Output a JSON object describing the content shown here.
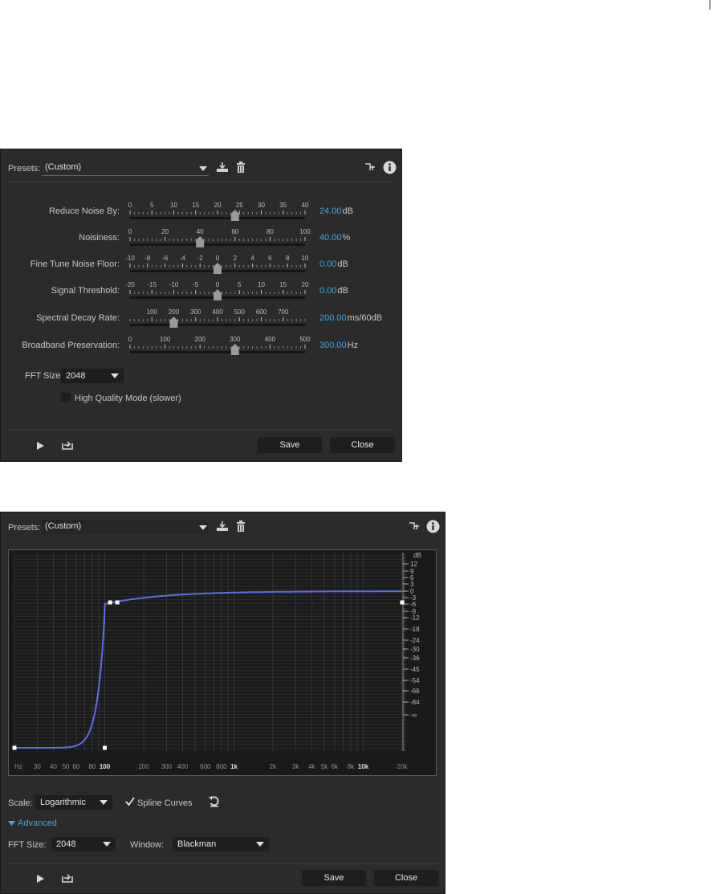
{
  "panel1": {
    "presets_label": "Presets:",
    "preset_value": "(Custom)",
    "sliders": [
      {
        "id": "reduce-noise",
        "label": "Reduce Noise By:",
        "ticks": [
          "0",
          "5",
          "10",
          "15",
          "20",
          "25",
          "30",
          "35",
          "40"
        ],
        "min": 0,
        "max": 40,
        "value": 24,
        "value_text": "24.00",
        "unit": "dB",
        "tick_numeric": [
          0,
          5,
          10,
          15,
          20,
          25,
          30,
          35,
          40
        ]
      },
      {
        "id": "noisiness",
        "label": "Noisiness:",
        "ticks": [
          "0",
          "20",
          "40",
          "60",
          "80",
          "100"
        ],
        "min": 0,
        "max": 100,
        "value": 40,
        "value_text": "40.00",
        "unit": "%",
        "tick_numeric": [
          0,
          20,
          40,
          60,
          80,
          100
        ]
      },
      {
        "id": "fine-tune",
        "label": "Fine Tune Noise Floor:",
        "ticks": [
          "-10",
          "-8",
          "-6",
          "-4",
          "-2",
          "0",
          "2",
          "4",
          "6",
          "8",
          "10"
        ],
        "min": -10,
        "max": 10,
        "value": 0,
        "value_text": "0.00",
        "unit": "dB",
        "tick_numeric": [
          -10,
          -8,
          -6,
          -4,
          -2,
          0,
          2,
          4,
          6,
          8,
          10
        ]
      },
      {
        "id": "signal-threshold",
        "label": "Signal Threshold:",
        "ticks": [
          "-20",
          "-15",
          "-10",
          "-5",
          "0",
          "5",
          "10",
          "15",
          "20"
        ],
        "min": -20,
        "max": 20,
        "value": 0,
        "value_text": "0.00",
        "unit": "dB",
        "tick_numeric": [
          -20,
          -15,
          -10,
          -5,
          0,
          5,
          10,
          15,
          20
        ]
      },
      {
        "id": "spectral-decay",
        "label": "Spectral Decay Rate:",
        "ticks": [
          "100",
          "200",
          "300",
          "400",
          "500",
          "600",
          "700"
        ],
        "min": 0,
        "max": 800,
        "value": 200,
        "value_text": "200.00",
        "unit": "ms/60dB",
        "tick_numeric": [
          100,
          200,
          300,
          400,
          500,
          600,
          700
        ]
      },
      {
        "id": "broadband",
        "label": "Broadband Preservation:",
        "ticks": [
          "0",
          "100",
          "200",
          "300",
          "400",
          "500"
        ],
        "min": 0,
        "max": 500,
        "value": 300,
        "value_text": "300.00",
        "unit": "Hz",
        "tick_numeric": [
          0,
          100,
          200,
          300,
          400,
          500
        ]
      }
    ],
    "fft_label": "FFT Size:",
    "fft_value": "2048",
    "hq_label": "High Quality Mode (slower)",
    "save_label": "Save",
    "close_label": "Close"
  },
  "panel2": {
    "presets_label": "Presets:",
    "preset_value": "(Custom)",
    "graph": {
      "x_ticks": [
        "Hz",
        "30",
        "40",
        "50",
        "60",
        "80",
        "100",
        "200",
        "300",
        "400",
        "600",
        "800",
        "1k",
        "2k",
        "3k",
        "4k",
        "5k",
        "6k",
        "8k",
        "10k",
        "20k"
      ],
      "x_ticks_bold": [
        "100",
        "1k",
        "10k"
      ],
      "x_tick_hz": [
        20,
        30,
        40,
        50,
        60,
        80,
        100,
        200,
        300,
        400,
        600,
        800,
        1000,
        2000,
        3000,
        4000,
        5000,
        6000,
        8000,
        10000,
        20000
      ],
      "y_unit": "dB",
      "y_ticks": [
        "12",
        "9",
        "6",
        "3",
        "0",
        "-3",
        "-6",
        "-9",
        "-12",
        "-18",
        "-24",
        "-30",
        "-36",
        "-45",
        "-54",
        "-66",
        "-84",
        "-∞"
      ],
      "y_tick_db": [
        12,
        9,
        6,
        3,
        0,
        -3,
        -6,
        -9,
        -12,
        -18,
        -24,
        -30,
        -36,
        -45,
        -54,
        -66,
        -84,
        -200
      ]
    },
    "scale_label": "Scale:",
    "scale_value": "Logarithmic",
    "spline_label": "Spline Curves",
    "advanced_label": "Advanced",
    "fft_label": "FFT Size:",
    "fft_value": "2048",
    "window_label": "Window:",
    "window_value": "Blackman",
    "save_label": "Save",
    "close_label": "Close"
  },
  "colors": {
    "accent": "#3ea8e6",
    "curve": "#5b6ee8",
    "panel_bg": "#2b2b2b"
  }
}
